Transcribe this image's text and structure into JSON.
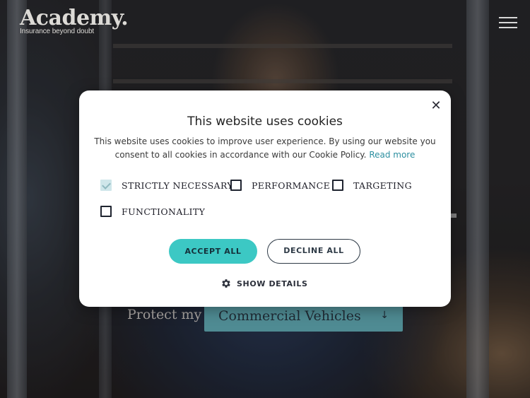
{
  "brand": {
    "name": "Academy.",
    "tagline": "Insurance beyond doubt"
  },
  "header": {
    "menu_icon": "hamburger-menu-icon"
  },
  "hero": {
    "protect_label": "Protect my",
    "protect_value": "Commercial Vehicles",
    "protect_arrow": "↓"
  },
  "cookie_modal": {
    "close_label": "✕",
    "title": "This website uses cookies",
    "description": "This website uses cookies to improve user experience. By using our website you consent to all cookies in accordance with our Cookie Policy. ",
    "read_more": "Read more",
    "options": [
      {
        "label": "STRICTLY NECESSARY",
        "checked": true,
        "disabled": true
      },
      {
        "label": "PERFORMANCE",
        "checked": false,
        "disabled": false
      },
      {
        "label": "TARGETING",
        "checked": false,
        "disabled": false
      },
      {
        "label": "FUNCTIONALITY",
        "checked": false,
        "disabled": false
      }
    ],
    "accept_all": "ACCEPT ALL",
    "decline_all": "DECLINE ALL",
    "show_details": "SHOW DETAILS",
    "show_details_icon": "gear-icon"
  },
  "colors": {
    "accent": "#3cc8c4",
    "link": "#2c8fa0",
    "select_bg": "#4f8b93"
  }
}
